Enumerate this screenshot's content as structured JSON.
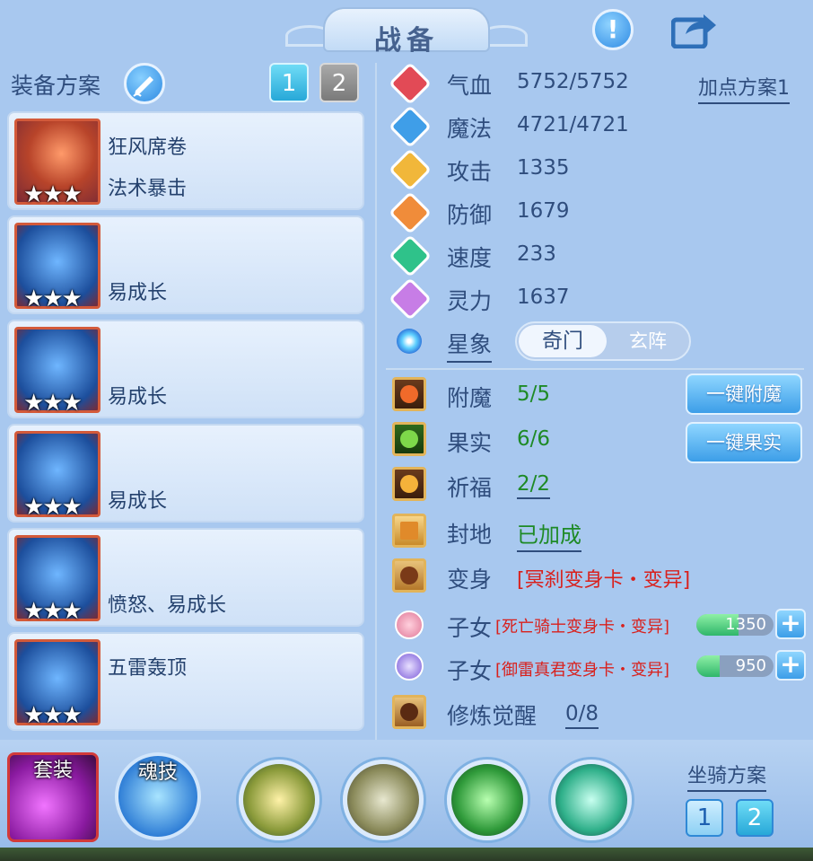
{
  "title": "战备",
  "left": {
    "scheme_label": "装备方案",
    "scheme_tabs": [
      "1",
      "2"
    ],
    "equipment": [
      {
        "name": "狂风席卷",
        "desc": "法术暴击",
        "stars": "★★★"
      },
      {
        "name": "",
        "desc": "易成长",
        "stars": "★★★"
      },
      {
        "name": "",
        "desc": "易成长",
        "stars": "★★★"
      },
      {
        "name": "",
        "desc": "易成长",
        "stars": "★★★"
      },
      {
        "name": "",
        "desc": "愤怒、易成长",
        "stars": "★★★"
      },
      {
        "name": "五雷轰顶",
        "desc": "",
        "stars": "★★★"
      }
    ]
  },
  "stats": {
    "plan_link": "加点方案1",
    "items": [
      {
        "label": "气血",
        "value": "5752/5752",
        "color": "#e24a56"
      },
      {
        "label": "魔法",
        "value": "4721/4721",
        "color": "#3f9ee8"
      },
      {
        "label": "攻击",
        "value": "1335",
        "color": "#f1b73a"
      },
      {
        "label": "防御",
        "value": "1679",
        "color": "#f08c3a"
      },
      {
        "label": "速度",
        "value": "233",
        "color": "#2fc28a"
      },
      {
        "label": "灵力",
        "value": "1637",
        "color": "#c77de6"
      }
    ],
    "star_label": "星象",
    "toggle": {
      "on": "奇门",
      "off": "玄阵"
    }
  },
  "extras": {
    "enchant": {
      "label": "附魔",
      "value": "5/5",
      "button": "一键附魔"
    },
    "fruit": {
      "label": "果实",
      "value": "6/6",
      "button": "一键果实"
    },
    "bless": {
      "label": "祈福",
      "value": "2/2"
    },
    "land": {
      "label": "封地",
      "value": "已加成"
    },
    "transform": {
      "label": "变身",
      "value": "[冥刹变身卡・变异]"
    },
    "children": [
      {
        "label": "子女",
        "value": "[死亡骑士变身卡・变异]",
        "bar_text": "1350",
        "progress": 0.55
      },
      {
        "label": "子女",
        "value": "[御雷真君变身卡・变异]",
        "bar_text": "950",
        "progress": 0.3
      }
    ],
    "awaken": {
      "label": "修炼觉醒",
      "value": "0/8"
    }
  },
  "bottom": {
    "set_label": "套装",
    "soul_label": "魂技",
    "mount_label": "坐骑方案",
    "mount_tabs": [
      "1",
      "2"
    ]
  }
}
